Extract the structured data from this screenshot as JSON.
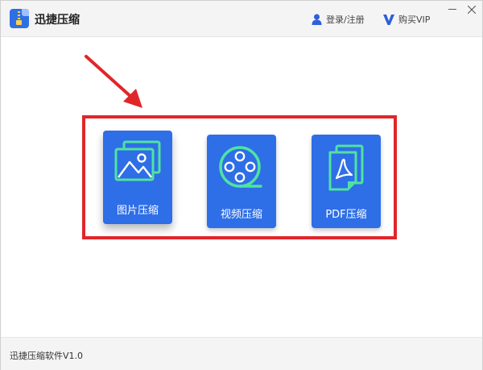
{
  "app": {
    "title": "迅捷压缩"
  },
  "header": {
    "login_label": "登录/注册",
    "vip_label": "购买VIP"
  },
  "window_controls": {
    "minimize": "minimize",
    "close": "close"
  },
  "tools": [
    {
      "label": "图片压缩",
      "icon": "image-icon"
    },
    {
      "label": "视频压缩",
      "icon": "film-reel-icon"
    },
    {
      "label": "PDF压缩",
      "icon": "pdf-file-icon"
    }
  ],
  "footer": {
    "version_text": "迅捷压缩软件V1.0"
  },
  "colors": {
    "accent": "#2e6ee7",
    "icon_green": "#4fe3a0",
    "highlight_red": "#e1262a",
    "vip_blue": "#2f5fd8"
  }
}
